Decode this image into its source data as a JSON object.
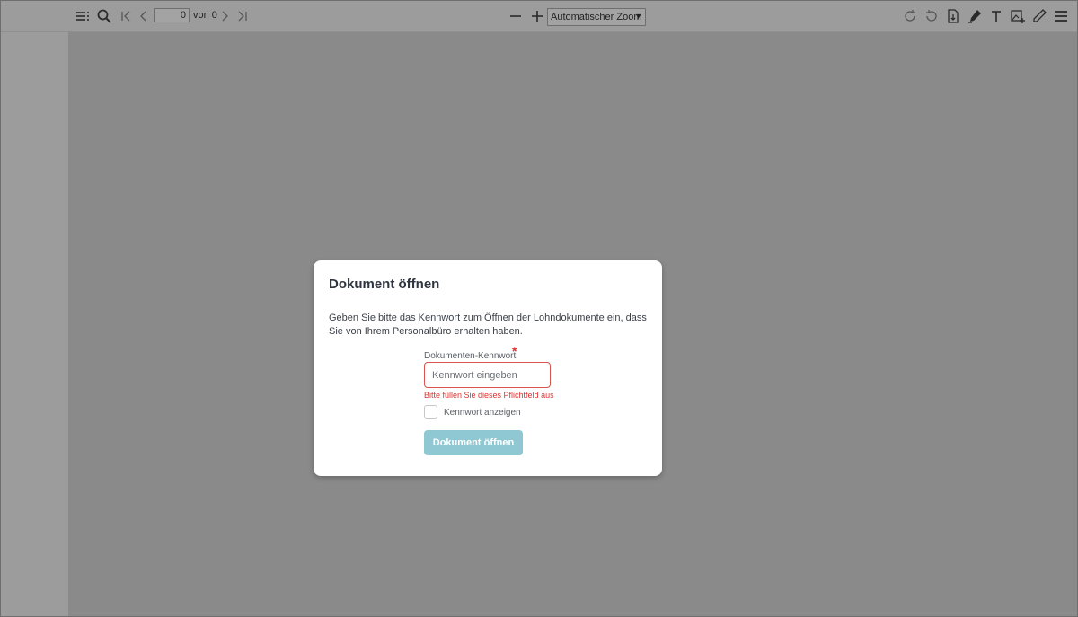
{
  "toolbar": {
    "page_number": "0",
    "page_of": "von 0",
    "zoom_value": "Automatischer Zoom"
  },
  "dialog": {
    "title": "Dokument öffnen",
    "description": "Geben Sie bitte das Kennwort zum Öffnen der Lohndokumente ein, dass Sie von Ihrem Personalbüro erhalten haben.",
    "field_label": "Dokumenten-Kennwort",
    "required_mark": "*",
    "password_placeholder": "Kennwort eingeben",
    "error": "Bitte füllen Sie dieses Pflichtfeld aus",
    "show_password_label": "Kennwort anzeigen",
    "submit_label": "Dokument öffnen"
  },
  "colors": {
    "button": "#8fc7d2",
    "error": "#e03131",
    "overlay": "#8a8a8b"
  }
}
